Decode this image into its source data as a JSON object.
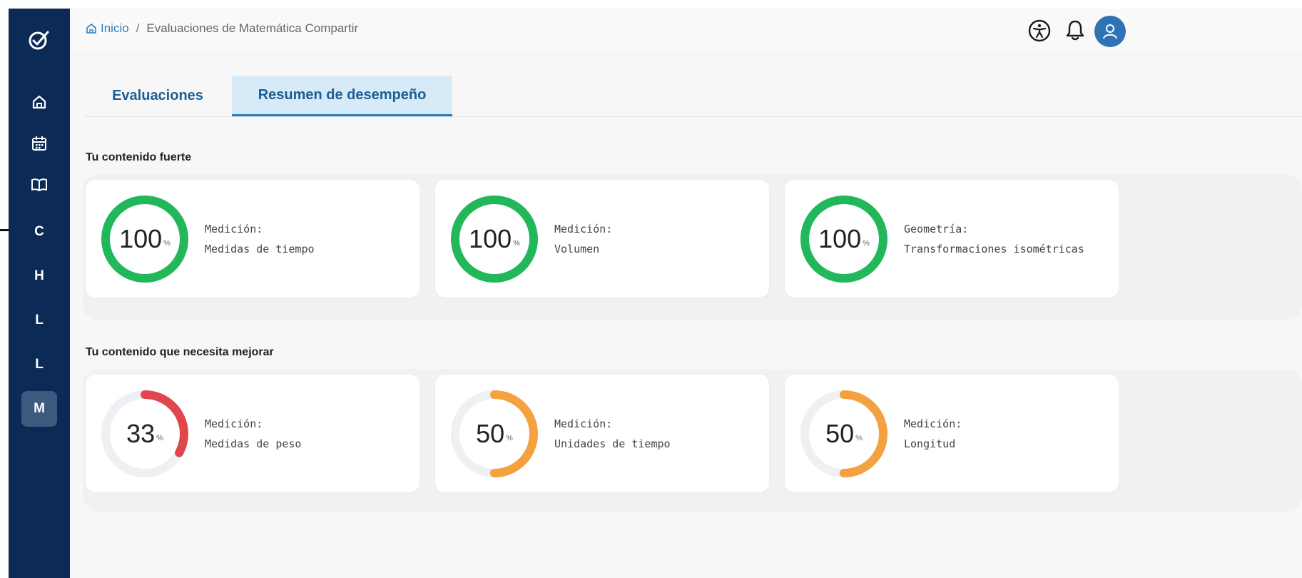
{
  "app": {
    "logo_icon": "check-badge-icon"
  },
  "sidebar": {
    "icons": [
      "home-icon",
      "calendar-icon",
      "book-icon"
    ],
    "items": [
      {
        "label": "C"
      },
      {
        "label": "H"
      },
      {
        "label": "L"
      },
      {
        "label": "L"
      },
      {
        "label": "M",
        "active": true
      }
    ]
  },
  "header": {
    "breadcrumb": {
      "home_label": "Inicio",
      "separator": "/",
      "current": "Evaluaciones de Matemática Compartir"
    },
    "icons": [
      "accessibility-icon",
      "bell-icon",
      "user-avatar-icon"
    ]
  },
  "tabs": [
    {
      "label": "Evaluaciones",
      "active": false
    },
    {
      "label": "Resumen de desempeño",
      "active": true
    }
  ],
  "sections": {
    "strong": {
      "title": "Tu contenido fuerte",
      "cards": [
        {
          "value": "100",
          "unit": "%",
          "percent": 100,
          "color": "#22b85a",
          "category": "Medición:",
          "topic": "Medidas de tiempo"
        },
        {
          "value": "100",
          "unit": "%",
          "percent": 100,
          "color": "#22b85a",
          "category": "Medición:",
          "topic": "Volumen"
        },
        {
          "value": "100",
          "unit": "%",
          "percent": 100,
          "color": "#22b85a",
          "category": "Geometría:",
          "topic": "Transformaciones isométricas"
        }
      ]
    },
    "improve": {
      "title": "Tu contenido que necesita mejorar",
      "cards": [
        {
          "value": "33",
          "unit": "%",
          "percent": 33,
          "color": "#e0474d",
          "category": "Medición:",
          "topic": "Medidas de peso"
        },
        {
          "value": "50",
          "unit": "%",
          "percent": 50,
          "color": "#f4a140",
          "category": "Medición:",
          "topic": "Unidades de tiempo"
        },
        {
          "value": "50",
          "unit": "%",
          "percent": 50,
          "color": "#f4a140",
          "category": "Medición:",
          "topic": "Longitud"
        }
      ]
    }
  },
  "colors": {
    "sidebar_bg": "#0b2a55",
    "accent": "#2b7cbf",
    "ring_track": "#eef0f3"
  }
}
